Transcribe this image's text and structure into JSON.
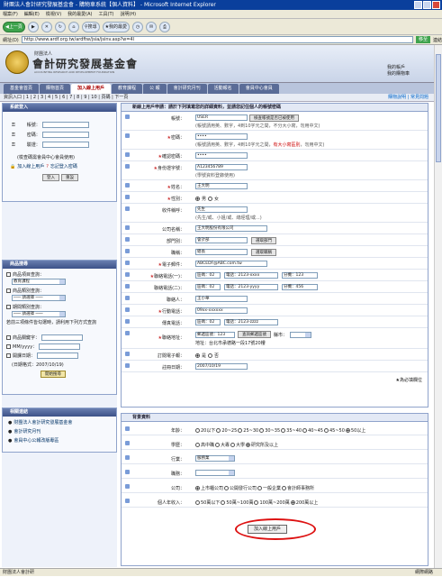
{
  "window": {
    "title": "財團法人會計研究發展基金會 - 購物車系統【個人資料】 - Microsoft Internet Explorer"
  },
  "menu": [
    "檔案(F)",
    "編輯(E)",
    "檢視(V)",
    "我的最愛(A)",
    "工具(T)",
    "說明(H)"
  ],
  "toolbar": {
    "back": "上一頁",
    "search": "搜尋",
    "favorites": "我的最愛"
  },
  "address": {
    "label": "網址(D)",
    "url": "http://www.ardf.org.tw/ardftw/jsia/jsinv.asp?w=4l",
    "go": "移至",
    "links": "連結"
  },
  "header": {
    "org_small": "財團法人",
    "org_name": "會計研究發展基金會",
    "org_en": "ACCOUNTING RESEARCH AND DEVELOPMENT FOUNDATION",
    "links": [
      "我的帳戶",
      "我的購物車"
    ]
  },
  "nav": {
    "tabs": [
      "基金會首頁",
      "購物首頁",
      "加入線上用戶",
      "教育課程",
      "公 報",
      "會計研究月刊",
      "活動報名",
      "會員中心會員"
    ],
    "active": 2
  },
  "subbar": {
    "left": "資訊入口 | 1 | 2 | 3 | 4 | 5 | 6 | 7 | 8 | 9 | 10 | 頁碼 | 下一頁",
    "right": [
      "購物說明",
      "常見問題"
    ]
  },
  "login": {
    "title": "系統登入",
    "account": "帳號：",
    "password": "密碼：",
    "code": "驗證：",
    "note": "(檢查碼需會員中心會員使用)",
    "join": "加入線上用戶",
    "forgot": "忘記登入密碼",
    "login_btn": "登入",
    "reset_btn": "重設"
  },
  "search": {
    "title": "商品搜尋",
    "c1": "商品項目查詢：",
    "c1v": "教育課程",
    "c2": "商品類別查詢：",
    "c2v": "─── 請選擇 ───",
    "c3": "期間類別查詢：",
    "c3v": "─── 請選擇 ───",
    "note": "若前三項條件皆勾選時，請利用下列方式查詢",
    "kw": "商品關鍵字：",
    "kwv": "",
    "kw2": "MM/yyyy：",
    "kw3": "開課日期：",
    "dfmt": "(日期格式：2007/10/19)",
    "btn": "開始搜尋"
  },
  "links": {
    "title": "相關連結",
    "items": [
      "財團法人會計研究發展基金會",
      "會計研究月刊",
      "會員中心公報改版專區"
    ]
  },
  "reg": {
    "title": "新線上用戶申請：請於下列填寫您的詳細資料，並請您記住個人的帳號密碼",
    "account": {
      "label": "帳號：",
      "value": "USER",
      "btn": "檢查帳號是否已被使用",
      "hint": "(帳號請用英、數字，4到10字元之間，不分大小寫，勿用中文)"
    },
    "password": {
      "label": "密碼：",
      "value": "••••",
      "hint": "(帳號請用英、數字，4到10字元之間，",
      "hint2": "有大小寫區別",
      "hint3": "，勿用中文)"
    },
    "confirm": {
      "label": "確認密碼：",
      "value": "••••"
    },
    "id": {
      "label": "身份證字號：",
      "value": "A123456789",
      "hint": "(學號資料登錄使用)"
    },
    "name": {
      "label": "姓名：",
      "value": "王大明"
    },
    "gender": {
      "label": "性別：",
      "male": "男",
      "female": "女"
    },
    "salutation": {
      "label": "收件稱呼：",
      "value": "先生",
      "hint": "(先生/或、小姐/或、總經理/或...)"
    },
    "company": {
      "label": "公司名稱：",
      "value": "王大明股份有限公司"
    },
    "dept": {
      "label": "部門別：",
      "value": "會計部",
      "btn": "選取部門"
    },
    "title_f": {
      "label": "職稱：",
      "value": "組長",
      "btn": "選取職稱"
    },
    "email": {
      "label": "電子郵件：",
      "value": "ABCEDF@ABC.com.tw"
    },
    "phone1": {
      "label": "聯絡電話(一)：",
      "area": "區碼：02",
      "num": "電話：2123-xxxx",
      "ext": "分機：123"
    },
    "phone2": {
      "label": "聯絡電話(二)：",
      "area": "區碼：02",
      "num": "電話：2123-yyyy",
      "ext": "分機：456"
    },
    "contact": {
      "label": "聯絡人：",
      "value": "王小華"
    },
    "mobile": {
      "label": "行動電話：",
      "value": "09xx-xxxxxx"
    },
    "fax": {
      "label": "傳真電話：",
      "area": "區碼：02",
      "num": "電話：2123-zzzz"
    },
    "addr": {
      "label": "聯絡地址：",
      "zip": "郵遞區號：123",
      "btn": "查詢郵遞區號",
      "city": "縣市：",
      "addr": "地址：台北市承德路一段17號20樓"
    },
    "subscribe": {
      "label": "訂閱電子報：",
      "yes": "是",
      "no": "否"
    },
    "date": {
      "label": "註冊日期：",
      "value": "2007/10/19"
    },
    "required": "★為必填欄位"
  },
  "bg": {
    "title": "背景資料",
    "age": {
      "label": "年齡：",
      "opts": [
        "20以下",
        "20~25",
        "25~30",
        "30~35",
        "35~40",
        "40~45",
        "45~50",
        "50以上"
      ],
      "sel": 7
    },
    "edu": {
      "label": "學歷：",
      "opts": [
        "高中職",
        "大專",
        "大學",
        "研究所及以上"
      ],
      "sel": 3
    },
    "industry": {
      "label": "行業：",
      "value": "服務業"
    },
    "role": {
      "label": "職務：",
      "value": ""
    },
    "ctype": {
      "label": "公司：",
      "opts": [
        "上市櫃公司",
        "公開發行公司",
        "一般企業",
        "會計師事務所"
      ],
      "sel": 0
    },
    "income": {
      "label": "個人年收入：",
      "opts": [
        "50萬以下",
        "50萬~100萬",
        "100萬~200萬",
        "200萬以上"
      ],
      "sel": 3
    },
    "submit": "加入線上用戶"
  },
  "status": {
    "left": "財團法人會計研",
    "right": "網際網路"
  }
}
